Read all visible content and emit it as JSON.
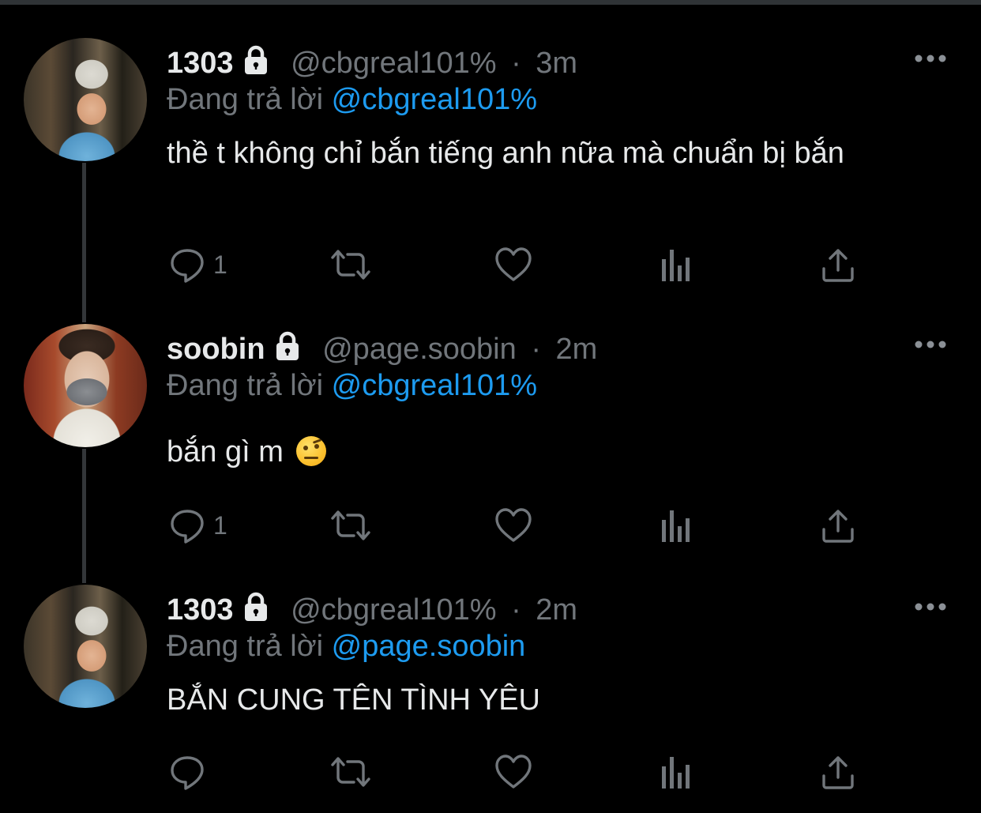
{
  "colors": {
    "background": "#000000",
    "text": "#e7e9ea",
    "secondary": "#71767b",
    "accent": "#1d9bf0",
    "thread_line": "#333639"
  },
  "tweets": [
    {
      "name": "1303",
      "lock_icon": "lock-icon",
      "handle": "@cbgreal101%",
      "dot": "·",
      "time": "3m",
      "reply_prefix": "Đang trả lời",
      "reply_to": "@cbgreal101%",
      "text": "thề t không chỉ bắn tiếng anh nữa mà chuẩn bị bắn",
      "reply_count": "1",
      "avatar": "avatar-kid-helmet"
    },
    {
      "name": "soobin",
      "lock_icon": "lock-icon",
      "handle": "@page.soobin",
      "dot": "·",
      "time": "2m",
      "reply_prefix": "Đang trả lời",
      "reply_to": "@cbgreal101%",
      "text": "bắn gì m",
      "emoji": "raised-eyebrow-face-emoji",
      "reply_count": "1",
      "avatar": "avatar-masked-person"
    },
    {
      "name": "1303",
      "lock_icon": "lock-icon",
      "handle": "@cbgreal101%",
      "dot": "·",
      "time": "2m",
      "reply_prefix": "Đang trả lời",
      "reply_to": "@page.soobin",
      "text": "BẮN CUNG TÊN TÌNH YÊU",
      "reply_count": "",
      "avatar": "avatar-kid-helmet"
    }
  ],
  "icons": [
    "reply-icon",
    "retweet-icon",
    "like-icon",
    "analytics-icon",
    "share-icon",
    "more-options-icon"
  ]
}
